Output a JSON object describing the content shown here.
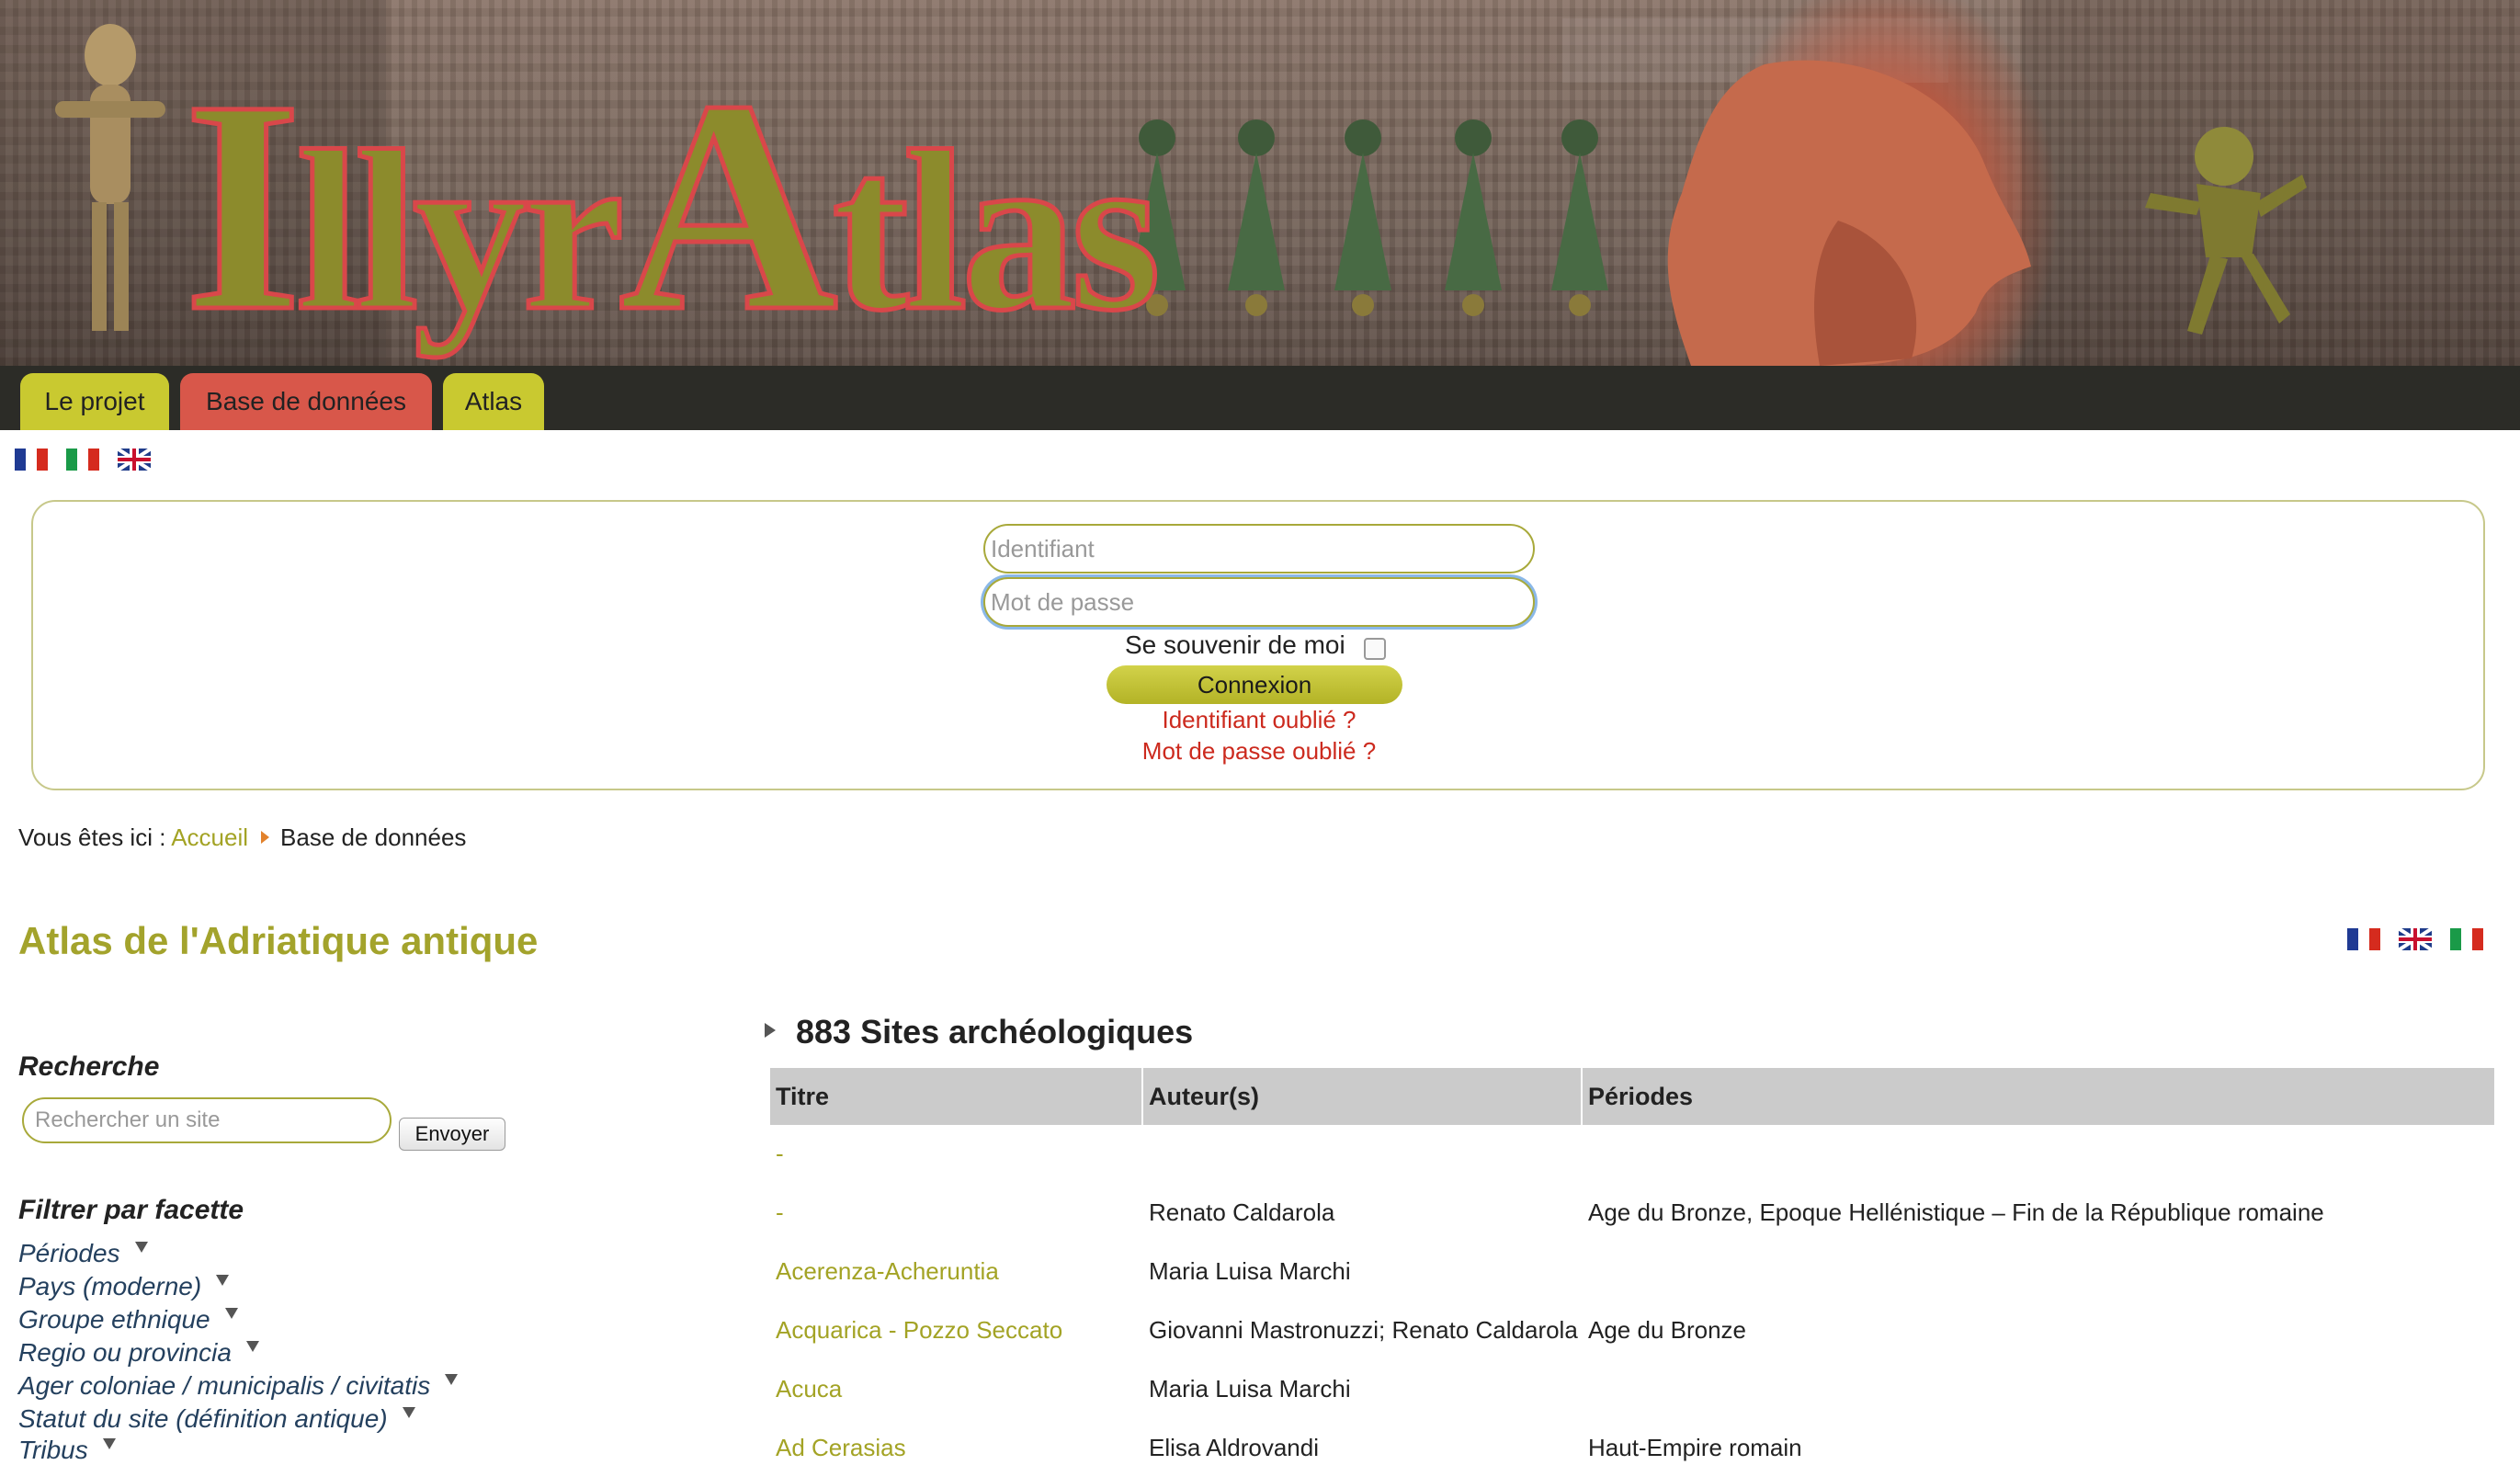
{
  "banner": {
    "logo_part1": "I",
    "logo_part2": "llyr",
    "logo_part3": "A",
    "logo_part4": "tlas"
  },
  "nav": {
    "tabs": [
      {
        "label": "Le projet",
        "color": "#c9c930"
      },
      {
        "label": "Base de données",
        "color": "#d8574a"
      },
      {
        "label": "Atlas",
        "color": "#c9c930"
      }
    ]
  },
  "languages": [
    "fr",
    "it",
    "en"
  ],
  "login": {
    "username_placeholder": "Identifiant",
    "password_placeholder": "Mot de passe",
    "remember_label": "Se souvenir de moi",
    "submit_label": "Connexion",
    "forgot_username": "Identifiant oublié ?",
    "forgot_password": "Mot de passe oublié ?"
  },
  "breadcrumb": {
    "prefix": "Vous êtes ici :",
    "home": "Accueil",
    "current": "Base de données"
  },
  "page": {
    "title": "Atlas de l'Adriatique antique"
  },
  "sidebar": {
    "search_heading": "Recherche",
    "search_placeholder": "Rechercher un site",
    "search_button": "Envoyer",
    "facet_heading": "Filtrer par facette",
    "facets": [
      "Périodes",
      "Pays (moderne)",
      "Groupe ethnique",
      "Regio ou provincia",
      "Ager coloniae / municipalis / civitatis",
      "Statut du site (définition antique)",
      "Tribus"
    ]
  },
  "sites": {
    "heading": "883 Sites archéologiques",
    "columns": [
      "Titre",
      "Auteur(s)",
      "Périodes"
    ],
    "rows": [
      {
        "title": "-",
        "authors": "",
        "periods": ""
      },
      {
        "title": "-",
        "authors": "Renato Caldarola",
        "periods": "Age du Bronze, Epoque Hellénistique – Fin de la République romaine"
      },
      {
        "title": "Acerenza-Acheruntia",
        "authors": "Maria Luisa Marchi",
        "periods": ""
      },
      {
        "title": "Acquarica - Pozzo Seccato",
        "authors": "Giovanni Mastronuzzi; Renato Caldarola",
        "periods": "Age du Bronze"
      },
      {
        "title": "Acuca",
        "authors": "Maria Luisa Marchi",
        "periods": ""
      },
      {
        "title": "Ad Cerasias",
        "authors": "Elisa Aldrovandi",
        "periods": "Haut-Empire romain"
      }
    ]
  },
  "colors": {
    "accent_olive": "#a3a325",
    "link_red": "#cc2a1e",
    "nav_dark": "#2c2c27",
    "table_header": "#cbcbcb"
  }
}
